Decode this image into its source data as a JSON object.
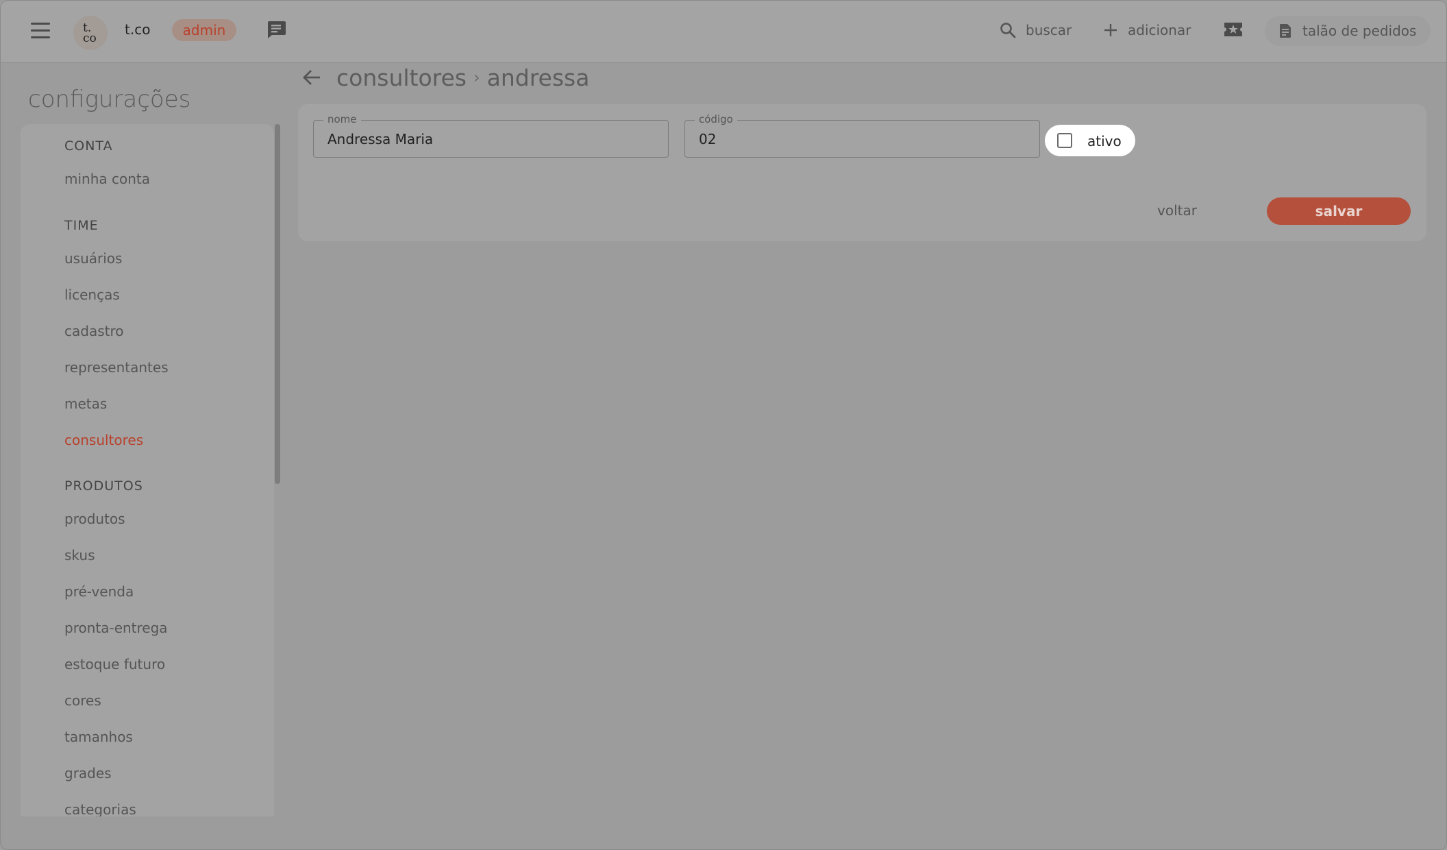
{
  "header": {
    "logo_line1": "t.",
    "logo_line2": "co",
    "brand": "t.co",
    "role_badge": "admin",
    "search_label": "buscar",
    "add_label": "adicionar",
    "order_book_label": "talão de pedidos"
  },
  "sidebar": {
    "title": "configurações",
    "sections": [
      {
        "heading": "CONTA",
        "items": [
          "minha conta"
        ]
      },
      {
        "heading": "TIME",
        "items": [
          "usuários",
          "licenças",
          "cadastro",
          "representantes",
          "metas",
          "consultores"
        ]
      },
      {
        "heading": "PRODUTOS",
        "items": [
          "produtos",
          "skus",
          "pré-venda",
          "pronta-entrega",
          "estoque futuro",
          "cores",
          "tamanhos",
          "grades",
          "categorias"
        ]
      }
    ],
    "active_item": "consultores"
  },
  "main": {
    "breadcrumb": {
      "parent": "consultores",
      "separator": "›",
      "current": "andressa"
    },
    "form": {
      "name_label": "nome",
      "name_value": "Andressa Maria",
      "code_label": "código",
      "code_value": "02",
      "active_label": "ativo",
      "active_checked": false
    },
    "back_button": "voltar",
    "save_button": "salvar"
  },
  "colors": {
    "accent": "#b8412c",
    "save_button_bg": "#b5503c",
    "overlay_bg": "#9c9c9c"
  }
}
